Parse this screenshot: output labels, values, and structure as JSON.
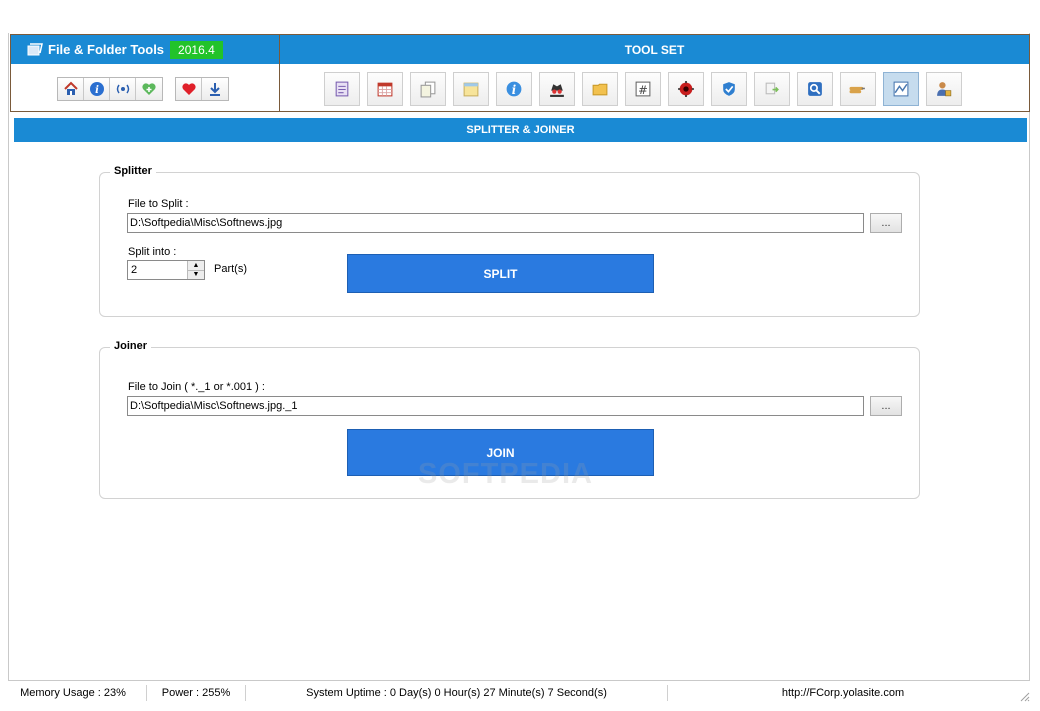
{
  "app": {
    "title": "File & Folder Tools",
    "version": "2016.4"
  },
  "nav": {
    "group1": [
      "home-icon",
      "info-icon",
      "broadcast-icon",
      "health-plus-icon"
    ],
    "group2": [
      "heart-icon",
      "download-icon"
    ]
  },
  "toolset": {
    "title": "TOOL SET",
    "tools": [
      "notepad-icon",
      "calendar-icon",
      "copy-pages-icon",
      "note-icon",
      "info-circle-icon",
      "spy-icon",
      "folder-icon",
      "hash-icon",
      "virus-icon",
      "shield-icon",
      "rename-icon",
      "search-icon",
      "hand-pointer-icon",
      "splitter-icon",
      "user-lock-icon"
    ],
    "active_index": 13
  },
  "section": {
    "title": "SPLITTER & JOINER"
  },
  "splitter": {
    "group_title": "Splitter",
    "file_label": "File to Split :",
    "file_value": "D:\\Softpedia\\Misc\\Softnews.jpg",
    "browse_label": "...",
    "split_label": "Split into :",
    "parts_value": "2",
    "parts_unit": "Part(s)",
    "button_label": "SPLIT"
  },
  "joiner": {
    "group_title": "Joiner",
    "file_label": "File to Join ( *._1  or *.001 ) :",
    "file_value": "D:\\Softpedia\\Misc\\Softnews.jpg._1",
    "browse_label": "...",
    "button_label": "JOIN"
  },
  "watermark": "SOFTPEDIA",
  "status": {
    "memory": "Memory Usage : 23%",
    "power": "Power : 255%",
    "uptime": "System Uptime : 0 Day(s) 0 Hour(s) 27 Minute(s) 7 Second(s)",
    "url": "http://FCorp.yolasite.com"
  },
  "colors": {
    "accent_blue": "#1a8ad4",
    "button_blue": "#2a7ae0",
    "badge_green": "#22c32a"
  }
}
